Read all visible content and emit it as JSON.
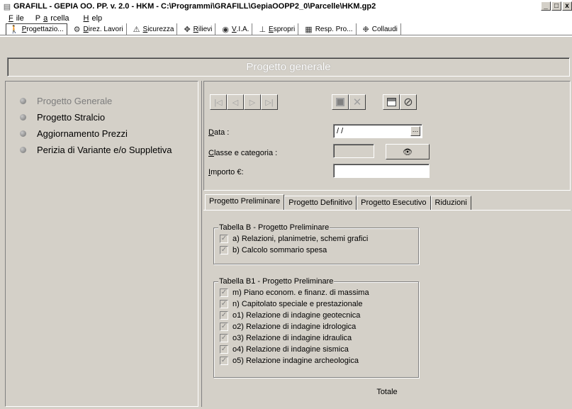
{
  "window": {
    "title": "GRAFILL - GEPIA OO. PP. v. 2.0 - HKM - C:\\Programmi\\GRAFILL\\GepiaOOPP2_0\\Parcelle\\HKM.gp2",
    "controls": [
      "_",
      "□",
      "x"
    ]
  },
  "menu": {
    "items": [
      {
        "pre": "",
        "u": "F",
        "rest": "ile"
      },
      {
        "pre": "P",
        "u": "a",
        "rest": "rcella"
      },
      {
        "pre": "",
        "u": "H",
        "rest": "elp"
      }
    ]
  },
  "toolbar": {
    "tabs": [
      {
        "icon": "person-icon",
        "glyph": "🚶",
        "u": "P",
        "rest": "rogettazio...",
        "active": true
      },
      {
        "icon": "directions-icon",
        "glyph": "⚙",
        "u": "D",
        "rest": "irez. Lavori",
        "active": false
      },
      {
        "icon": "warning-icon",
        "glyph": "⚠",
        "u": "S",
        "rest": "icurezza",
        "active": false
      },
      {
        "icon": "survey-icon",
        "glyph": "✥",
        "u": "R",
        "rest": "ilievi",
        "active": false
      },
      {
        "icon": "globe-icon",
        "glyph": "◉",
        "u": "V",
        "rest": ".I.A.",
        "active": false
      },
      {
        "icon": "expropriation-icon",
        "glyph": "⊥",
        "u": "E",
        "rest": "spropri",
        "active": false
      },
      {
        "icon": "responsible-icon",
        "glyph": "▦",
        "u": "",
        "rest": "Resp. Pro...",
        "active": false
      },
      {
        "icon": "testing-icon",
        "glyph": "❉",
        "u": "",
        "rest": "Collaudi",
        "active": false
      }
    ]
  },
  "header": {
    "title": "Progetto generale"
  },
  "options": [
    {
      "label": "Progetto Generale",
      "dim": true
    },
    {
      "label": "Progetto Stralcio",
      "dim": false
    },
    {
      "label": "Aggiornamento Prezzi",
      "dim": false
    },
    {
      "label": "Perizia di Variante e/o Suppletiva",
      "dim": false
    }
  ],
  "nav": {
    "first": "|◁",
    "prev": "◁",
    "next": "▷",
    "last": "▷|"
  },
  "form": {
    "data_label_u": "D",
    "data_label_rest": "ata :",
    "data_value": "/ /",
    "classe_label_u": "C",
    "classe_label_rest": "lasse e categoria :",
    "classe_value": "",
    "importo_label_u": "I",
    "importo_label_rest": "mporto €:",
    "importo_value": ""
  },
  "tabs": [
    {
      "label": "Progetto Preliminare",
      "selected": true
    },
    {
      "label": "Progetto Definitivo",
      "selected": false
    },
    {
      "label": "Progetto Esecutivo",
      "selected": false
    },
    {
      "label": "Riduzioni",
      "selected": false
    }
  ],
  "groupB": {
    "title": "Tabella B - Progetto Preliminare",
    "items": [
      "a) Relazioni, planimetrie, schemi grafici",
      "b) Calcolo sommario spesa"
    ]
  },
  "groupB1": {
    "title": "Tabella B1 - Progetto Preliminare",
    "items": [
      "m) Piano econom. e finanz. di massima",
      "n) Capitolato speciale e prestazionale",
      "o1) Relazione di indagine geotecnica",
      "o2) Relazione di indagine idrologica",
      "o3) Relazione di indagine idraulica",
      "o4) Relazione di indagine sismica",
      "o5) Relazione indagine archeologica"
    ]
  },
  "totale_label": "Totale"
}
